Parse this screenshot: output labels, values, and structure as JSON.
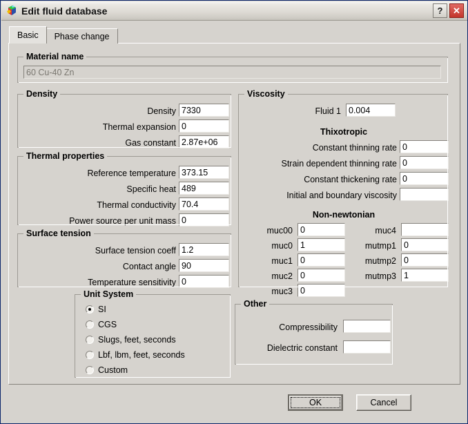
{
  "window": {
    "title": "Edit fluid database",
    "app_icon": "cube-icon",
    "help_button": "?",
    "close_button": "✕"
  },
  "tabs": [
    {
      "label": "Basic",
      "active": true
    },
    {
      "label": "Phase change",
      "active": false
    }
  ],
  "material_name": {
    "group_label": "Material name",
    "value": "60 Cu-40 Zn",
    "disabled": true
  },
  "density": {
    "group_label": "Density",
    "fields": [
      {
        "label": "Density",
        "value": "7330"
      },
      {
        "label": "Thermal expansion",
        "value": "0"
      },
      {
        "label": "Gas constant",
        "value": "2.87e+06"
      }
    ]
  },
  "thermal_properties": {
    "group_label": "Thermal properties",
    "fields": [
      {
        "label": "Reference temperature",
        "value": "373.15"
      },
      {
        "label": "Specific heat",
        "value": "489"
      },
      {
        "label": "Thermal conductivity",
        "value": "70.4"
      },
      {
        "label": "Power source per unit mass",
        "value": "0"
      }
    ]
  },
  "surface_tension": {
    "group_label": "Surface tension",
    "fields": [
      {
        "label": "Surface tension coeff",
        "value": "1.2"
      },
      {
        "label": "Contact angle",
        "value": "90"
      },
      {
        "label": "Temperature sensitivity",
        "value": "0"
      }
    ]
  },
  "viscosity": {
    "group_label": "Viscosity",
    "fluid": {
      "label": "Fluid 1",
      "value": "0.004"
    },
    "thixotropic": {
      "header": "Thixotropic",
      "fields": [
        {
          "label": "Constant thinning rate",
          "value": "0"
        },
        {
          "label": "Strain dependent thinning rate",
          "value": "0"
        },
        {
          "label": "Constant thickening rate",
          "value": "0"
        },
        {
          "label": "Initial and boundary viscosity",
          "value": ""
        }
      ]
    },
    "non_newtonian": {
      "header": "Non-newtonian",
      "left_fields": [
        {
          "label": "muc00",
          "value": "0"
        },
        {
          "label": "muc0",
          "value": "1"
        },
        {
          "label": "muc1",
          "value": "0"
        },
        {
          "label": "muc2",
          "value": "0"
        },
        {
          "label": "muc3",
          "value": "0"
        }
      ],
      "right_fields": [
        {
          "label": "muc4",
          "value": ""
        },
        {
          "label": "mutmp1",
          "value": "0"
        },
        {
          "label": "mutmp2",
          "value": "0"
        },
        {
          "label": "mutmp3",
          "value": "1"
        }
      ]
    }
  },
  "unit_system": {
    "group_label": "Unit System",
    "options": [
      {
        "label": "SI",
        "selected": true
      },
      {
        "label": "CGS",
        "selected": false
      },
      {
        "label": "Slugs, feet, seconds",
        "selected": false
      },
      {
        "label": "Lbf, lbm, feet, seconds",
        "selected": false
      },
      {
        "label": "Custom",
        "selected": false
      }
    ]
  },
  "other": {
    "group_label": "Other",
    "fields": [
      {
        "label": "Compressibility",
        "value": ""
      },
      {
        "label": "Dielectric constant",
        "value": ""
      }
    ]
  },
  "footer": {
    "ok_label": "OK",
    "cancel_label": "Cancel"
  },
  "colors": {
    "dialog_bg": "#d6d3ce",
    "title_border": "#0a246a",
    "close_red": "#c3352c",
    "field_bg": "#ffffff",
    "disabled_text": "#7a7770"
  }
}
